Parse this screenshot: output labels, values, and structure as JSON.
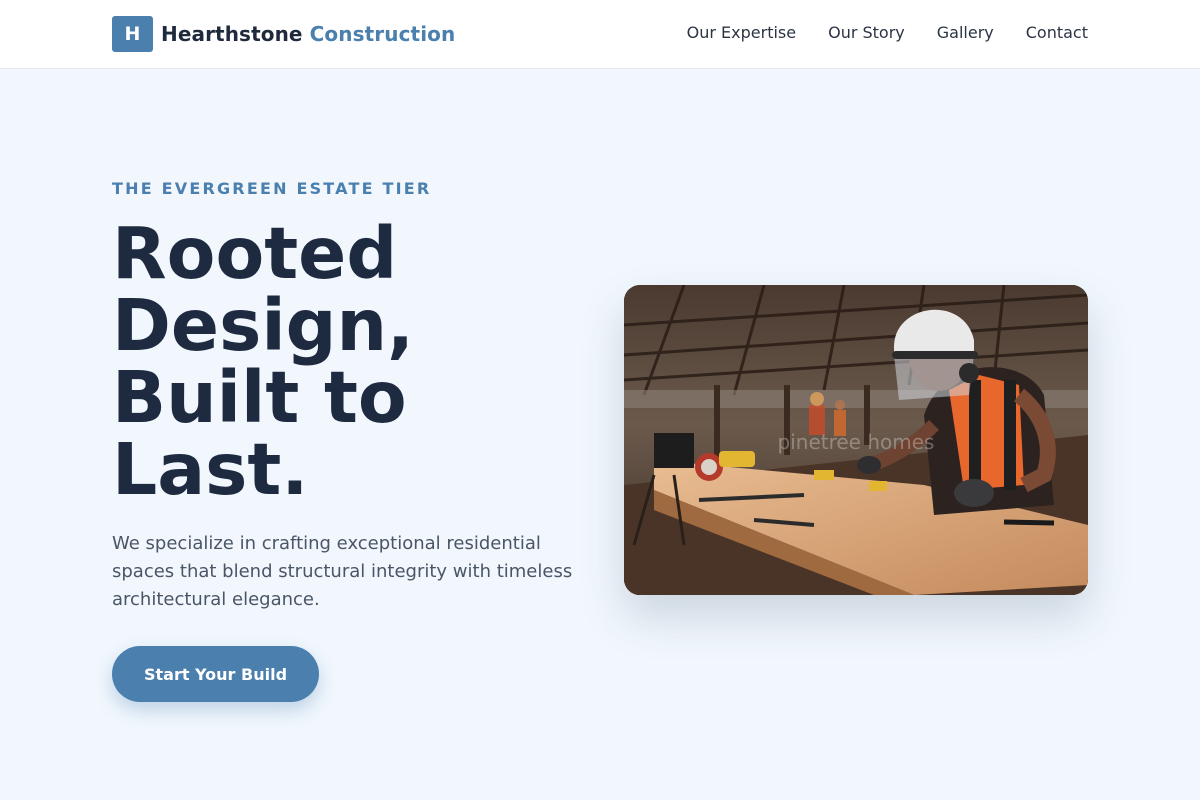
{
  "header": {
    "logo_letter": "H",
    "brand_primary": "Hearthstone",
    "brand_accent": "Construction",
    "nav": [
      {
        "label": "Our Expertise"
      },
      {
        "label": "Our Story"
      },
      {
        "label": "Gallery"
      },
      {
        "label": "Contact"
      }
    ]
  },
  "hero": {
    "eyebrow": "THE EVERGREEN ESTATE TIER",
    "headline_lines": [
      "Rooted",
      "Design,",
      "Built to",
      "Last."
    ],
    "description": "We specialize in crafting exceptional residential spaces that blend structural integrity with timeless architectural elegance.",
    "cta_label": "Start Your Build",
    "image_watermark": "pinetree homes",
    "image_subject": "worker-with-hard-hat-cutting-timber-beam"
  },
  "colors": {
    "accent": "#4a7fae",
    "headline": "#1d2a40",
    "page_background": "#f1f7fd",
    "body_text": "#4a5566"
  }
}
